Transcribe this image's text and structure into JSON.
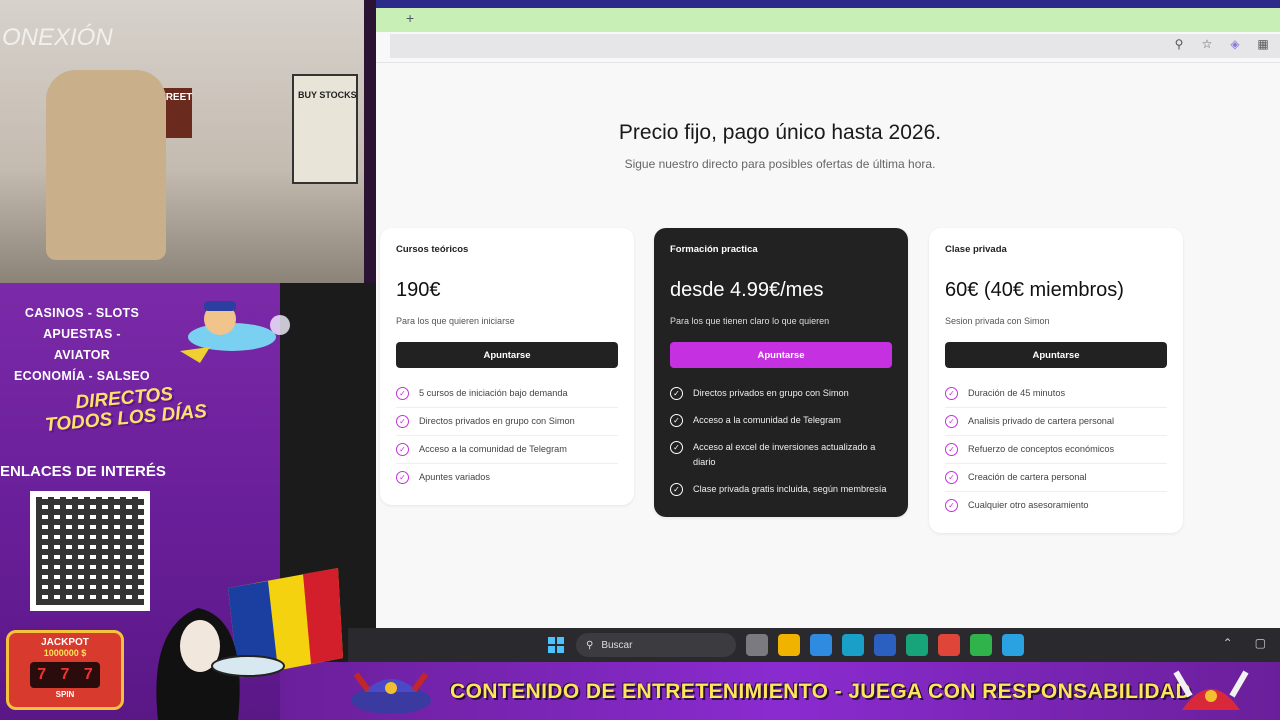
{
  "browser": {
    "new_tab_symbol": "+",
    "toolbar_icons": [
      "zoom-icon",
      "star-icon",
      "extension-icon",
      "puzzle-icon"
    ]
  },
  "page": {
    "headline": "Precio fijo, pago único hasta 2026.",
    "subheadline": "Sigue nuestro directo para posibles ofertas de última hora."
  },
  "plans": [
    {
      "title": "Cursos teóricos",
      "price": "190€",
      "description": "Para los que quieren iniciarse",
      "button": "Apuntarse",
      "features": [
        "5 cursos de iniciación bajo demanda",
        "Directos privados en grupo con Simon",
        "Acceso a la comunidad de Telegram",
        "Apuntes variados"
      ]
    },
    {
      "title": "Formación practica",
      "price": "desde 4.99€/mes",
      "description": "Para los que tienen claro lo que quieren",
      "button": "Apuntarse",
      "features": [
        "Directos privados en grupo con Simon",
        "Acceso a la comunidad de Telegram",
        "Acceso al excel de inversiones actualizado a diario",
        "Clase privada gratis incluida, según membresía"
      ]
    },
    {
      "title": "Clase privada",
      "price": "60€ (40€ miembros)",
      "description": "Sesion privada con Simon",
      "button": "Apuntarse",
      "features": [
        "Duración de 45 minutos",
        "Analisis privado de cartera personal",
        "Refuerzo de conceptos económicos",
        "Creación de cartera personal",
        "Cualquier otro asesoramiento"
      ]
    }
  ],
  "taskbar": {
    "search_placeholder": "Buscar",
    "app_colors": [
      "#7a7a80",
      "#f0b400",
      "#2f8be0",
      "#1aa0c8",
      "#2b5fc0",
      "#17a47a",
      "#e0453a",
      "#2fb34a",
      "#2aa1e0"
    ]
  },
  "stream_overlay": {
    "cam_text": "ONEXIÓN",
    "poster_wall_street": "WALL STREET",
    "poster_buy_stocks": "BUY STOCKS",
    "topics": [
      "CASINOS - SLOTS",
      "APUESTAS - AVIATOR",
      "ECONOMÍA - SALSEO"
    ],
    "directos_line1": "DIRECTOS",
    "directos_line2": "TODOS LOS DÍAS",
    "links_heading": "ENLACES DE INTERÉS",
    "jackpot_label": "JACKPOT",
    "jackpot_value": "1000000 $",
    "jackpot_button": "SPIN",
    "banner_text": "CONTENIDO DE ENTRETENIMIENTO - JUEGA CON RESPONSABILIDAD"
  },
  "colors": {
    "accent": "#c531e0",
    "dark_card": "#222222",
    "tab_strip": "#c8efb6",
    "overlay_purple": "#6a1f9a"
  }
}
